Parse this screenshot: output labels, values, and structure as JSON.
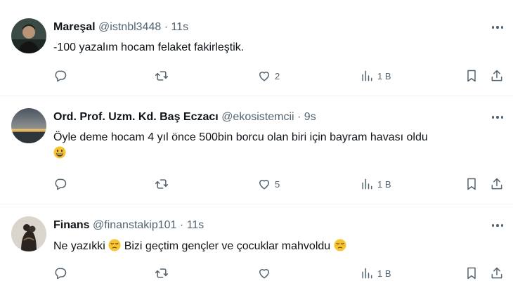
{
  "tweets": [
    {
      "name": "Mareşal",
      "handle": "@istnbl3448",
      "sep": "·",
      "time": "11s",
      "text": "-100 yazalım hocam felaket fakirleştik.",
      "text_suffix": "",
      "likes": "2",
      "views": "1 B"
    },
    {
      "name": "Ord. Prof. Uzm. Kd. Baş Eczacı",
      "handle": "@ekosistemcii",
      "sep": "·",
      "time": "9s",
      "text": "Öyle deme hocam 4 yıl önce 500bin borcu olan biri için bayram havası oldu",
      "emoji": "grinning-face",
      "likes": "5",
      "views": "1 B"
    },
    {
      "name": "Finans",
      "handle": "@finanstakip101",
      "sep": "·",
      "time": "11s",
      "text_part1": "Ne yazıkki",
      "text_part2": "Bizi geçtim gençler ve çocuklar mahvoldu",
      "emoji": "pensive-face",
      "likes": "",
      "views": "1 B"
    }
  ],
  "colors": {
    "text": "#0f1419",
    "secondary": "#536471",
    "divider": "#eff3f4",
    "emoji": "#f7c431"
  }
}
